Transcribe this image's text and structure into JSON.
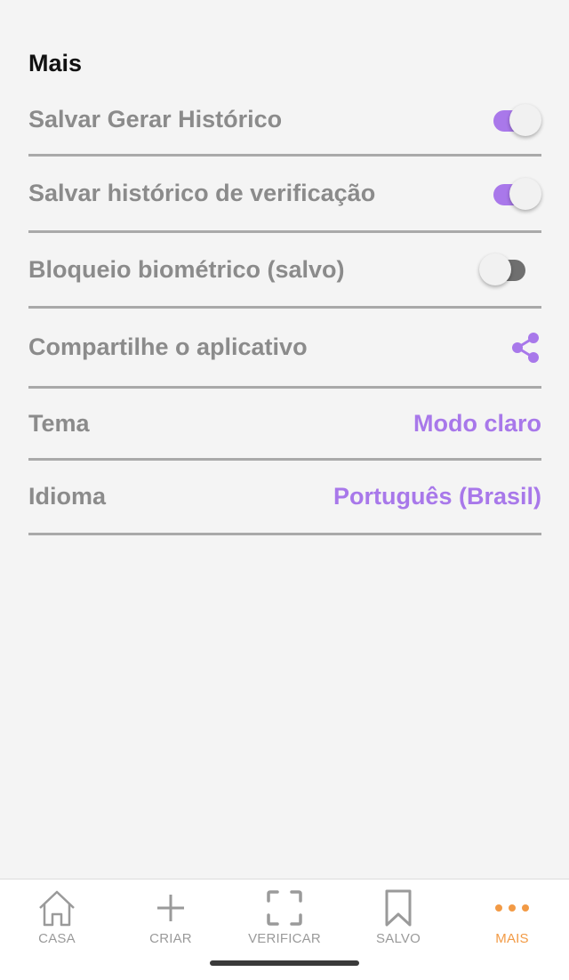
{
  "section_title": "Mais",
  "settings": {
    "save_generate_history": {
      "label": "Salvar Gerar Histórico",
      "enabled": true
    },
    "save_scan_history": {
      "label": "Salvar histórico de verificação",
      "enabled": true
    },
    "biometric_lock": {
      "label": "Bloqueio biométrico (salvo)",
      "enabled": false
    },
    "share_app": {
      "label": "Compartilhe o aplicativo",
      "icon": "share-icon"
    },
    "theme": {
      "label": "Tema",
      "value": "Modo claro"
    },
    "language": {
      "label": "Idioma",
      "value": "Português (Brasil)"
    }
  },
  "bottom_nav": {
    "items": [
      {
        "label": "CASA",
        "icon": "home-icon",
        "active": false
      },
      {
        "label": "CRIAR",
        "icon": "plus-icon",
        "active": false
      },
      {
        "label": "VERIFICAR",
        "icon": "scan-frame-icon",
        "active": false
      },
      {
        "label": "SALVO",
        "icon": "bookmark-icon",
        "active": false
      },
      {
        "label": "MAIS",
        "icon": "more-dots-icon",
        "active": true
      }
    ]
  },
  "colors": {
    "accent": "#a878ea",
    "nav_active": "#f29a45",
    "nav_inactive": "#9a9a9a",
    "label": "#8b8b8b",
    "background": "#f4f4f4"
  }
}
